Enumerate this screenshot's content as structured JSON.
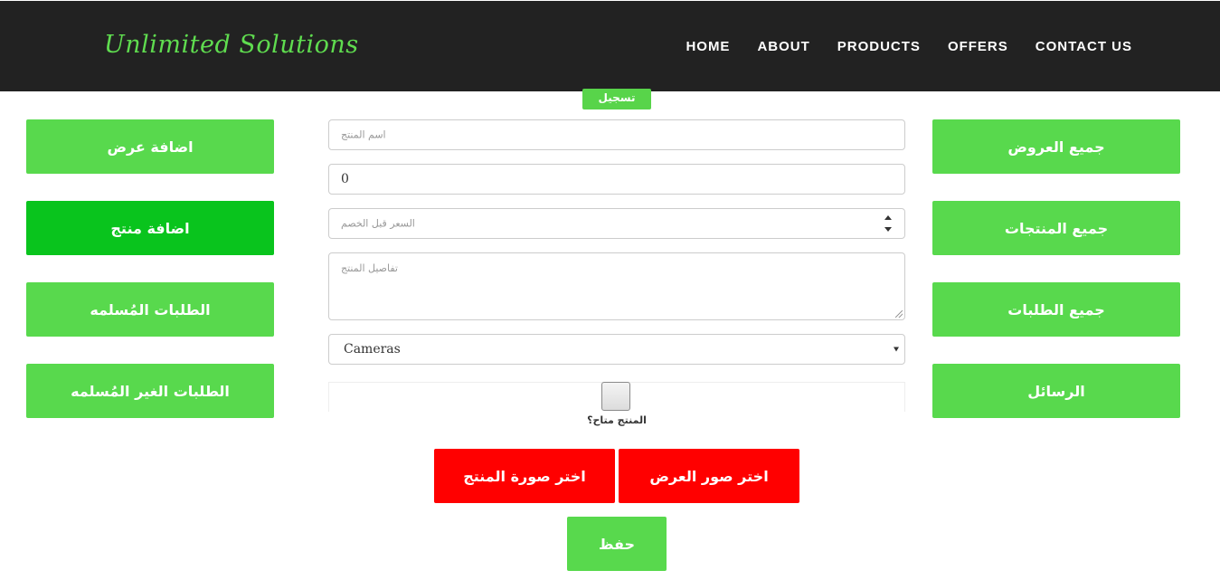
{
  "navbar": {
    "brand": "Unlimited Solutions",
    "links": [
      "HOME",
      "ABOUT",
      "PRODUCTS",
      "OFFERS",
      "CONTACT US"
    ]
  },
  "logout_label": "تسجيل خروج",
  "left_menu": [
    {
      "label": "اضافة عرض"
    },
    {
      "label": "اضافة منتج"
    },
    {
      "label": "الطلبات المُسلمه"
    },
    {
      "label": "الطلبات الغير المُسلمه"
    }
  ],
  "right_menu": [
    {
      "label": "جميع العروض"
    },
    {
      "label": "جميع المنتجات"
    },
    {
      "label": "جميع الطلبات"
    },
    {
      "label": "الرسائل"
    }
  ],
  "form": {
    "name_placeholder": "اسم المنتج",
    "price_value": "0",
    "old_price_placeholder": "السعر قبل الخصم",
    "details_placeholder": "تفاصيل المنتج",
    "category_selected": "Cameras",
    "available_label": "المنتج متاح؟",
    "choose_offer_images": "اختر صور العرض",
    "choose_product_image": "اختر صورة المنتج",
    "save_label": "حفظ"
  },
  "colors": {
    "navbar_bg": "#222222",
    "brand": "#5fdc4f",
    "menu_green": "#58d94d",
    "active_green": "#09c41d",
    "red": "#ff0000"
  },
  "icons": [
    "spinner-arrows-icon",
    "select-chevron-icon",
    "resize-grip-icon"
  ]
}
